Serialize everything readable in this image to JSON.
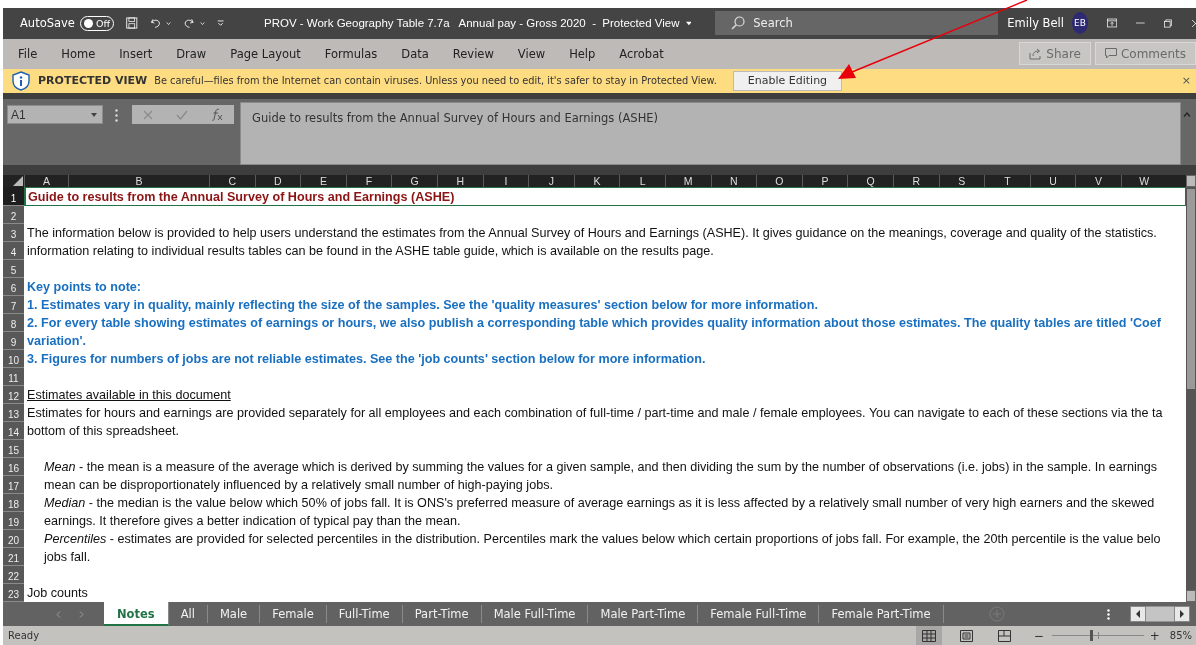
{
  "title_bar": {
    "autosave_label": "AutoSave",
    "autosave_toggle": {
      "label": "Off",
      "on": false
    },
    "title": "PROV - Work Geography Table 7.7a   Annual pay - Gross 2020  -  Protected View",
    "search": {
      "placeholder": "Search"
    },
    "user_name": "Emily Bell",
    "avatar_initials": "EB"
  },
  "menu": [
    "File",
    "Home",
    "Insert",
    "Draw",
    "Page Layout",
    "Formulas",
    "Data",
    "Review",
    "View",
    "Help",
    "Acrobat"
  ],
  "menu_buttons": [
    {
      "label": "Share",
      "kind": "share",
      "disabled": true
    },
    {
      "label": "Comments",
      "kind": "comments",
      "disabled": true
    }
  ],
  "protected_bar": {
    "title": "PROTECTED VIEW",
    "message": "Be careful—files from the Internet can contain viruses. Unless you need to edit, it's safer to stay in Protected View.",
    "button": "Enable Editing",
    "close": "×"
  },
  "formula_bar": {
    "name_box": "A1",
    "formula": "Guide to results from the Annual Survey of Hours and Earnings (ASHE)"
  },
  "columns": [
    "A",
    "B",
    "C",
    "D",
    "E",
    "F",
    "G",
    "H",
    "I",
    "J",
    "K",
    "L",
    "M",
    "N",
    "O",
    "P",
    "Q",
    "R",
    "S",
    "T",
    "U",
    "V",
    "W"
  ],
  "rows": [
    {
      "number": "1",
      "kind": "title",
      "selected": true,
      "text": "Guide to results from the Annual Survey of Hours and Earnings (ASHE)"
    },
    {
      "number": "2",
      "kind": "empty",
      "selected": false
    },
    {
      "number": "3",
      "kind": "text",
      "selected": false,
      "text": "The information below is provided to help users understand the estimates from the Annual Survey of Hours and Earnings (ASHE). It gives guidance on the meanings, coverage and quality of the statistics."
    },
    {
      "number": "4",
      "kind": "text",
      "selected": false,
      "text": "information relating to individual results tables can be found in the ASHE table guide, which is available on the results page."
    },
    {
      "number": "5",
      "kind": "empty",
      "selected": false
    },
    {
      "number": "6",
      "kind": "key",
      "selected": false,
      "text": "Key points to note:"
    },
    {
      "number": "7",
      "kind": "key",
      "selected": false,
      "text": "1. Estimates vary in quality, mainly reflecting the size of the samples. See the 'quality measures' section below for more information."
    },
    {
      "number": "8",
      "kind": "key",
      "selected": false,
      "text": "2. For every table showing estimates of earnings or hours, we also publish a corresponding table which provides quality information about those estimates. The quality tables are titled 'Coef"
    },
    {
      "number": "9",
      "kind": "key",
      "selected": false,
      "text": "variation'."
    },
    {
      "number": "10",
      "kind": "key",
      "selected": false,
      "text": "3. Figures for numbers of jobs are not reliable estimates. See the 'job counts' section below for more information."
    },
    {
      "number": "11",
      "kind": "empty",
      "selected": false
    },
    {
      "number": "12",
      "kind": "heading",
      "selected": false,
      "text": "Estimates available in this document"
    },
    {
      "number": "13",
      "kind": "text",
      "selected": false,
      "text": "Estimates for hours and earnings are provided separately for all employees and each combination of full-time / part-time and male / female employees. You can navigate to each of these sections via the ta"
    },
    {
      "number": "14",
      "kind": "text",
      "selected": false,
      "text": "bottom of this spreadsheet."
    },
    {
      "number": "15",
      "kind": "empty",
      "selected": false
    },
    {
      "number": "16",
      "kind": "definition",
      "selected": false,
      "text": "*Mean* - the mean is a measure of the average which is derived by summing the values for a given sample, and then dividing the sum by the number of observations (i.e. jobs) in the sample. In earnings"
    },
    {
      "number": "17",
      "kind": "definition",
      "selected": false,
      "text": "mean can be disproportionately influenced by a relatively small number of high-paying jobs."
    },
    {
      "number": "18",
      "kind": "definition",
      "selected": false,
      "text": "*Median* - the median is the value below which 50% of jobs fall. It is ONS's preferred measure of average earnings as it is less affected by a relatively small number of very high earners and the skewed"
    },
    {
      "number": "19",
      "kind": "definition",
      "selected": false,
      "text": "earnings. It therefore gives a better indication of typical pay than the mean."
    },
    {
      "number": "20",
      "kind": "definition",
      "selected": false,
      "text": "*Percentiles* - estimates are provided for selected percentiles in the distribution. Percentiles mark the values below which certain proportions of jobs fall. For example, the 20th percentile is the value belo"
    },
    {
      "number": "21",
      "kind": "definition",
      "selected": false,
      "text": "jobs fall."
    },
    {
      "number": "22",
      "kind": "empty",
      "selected": false
    },
    {
      "number": "23",
      "kind": "text",
      "selected": false,
      "text": "Job counts"
    }
  ],
  "sheet_tabs": [
    {
      "label": "Notes",
      "selected": true
    },
    {
      "label": "All",
      "selected": false
    },
    {
      "label": "Male",
      "selected": false
    },
    {
      "label": "Female",
      "selected": false
    },
    {
      "label": "Full-Time",
      "selected": false
    },
    {
      "label": "Part-Time",
      "selected": false
    },
    {
      "label": "Male Full-Time",
      "selected": false
    },
    {
      "label": "Male Part-Time",
      "selected": false
    },
    {
      "label": "Female Full-Time",
      "selected": false
    },
    {
      "label": "Female Part-Time",
      "selected": false
    }
  ],
  "status_bar": {
    "status": "Ready",
    "views": [
      {
        "kind": "normal",
        "selected": true
      },
      {
        "kind": "page-layout",
        "selected": false
      },
      {
        "kind": "page-break",
        "selected": false
      }
    ],
    "zoom": {
      "out_label": "−",
      "level": 0.42,
      "in_label": "+",
      "reading": "85%"
    }
  }
}
